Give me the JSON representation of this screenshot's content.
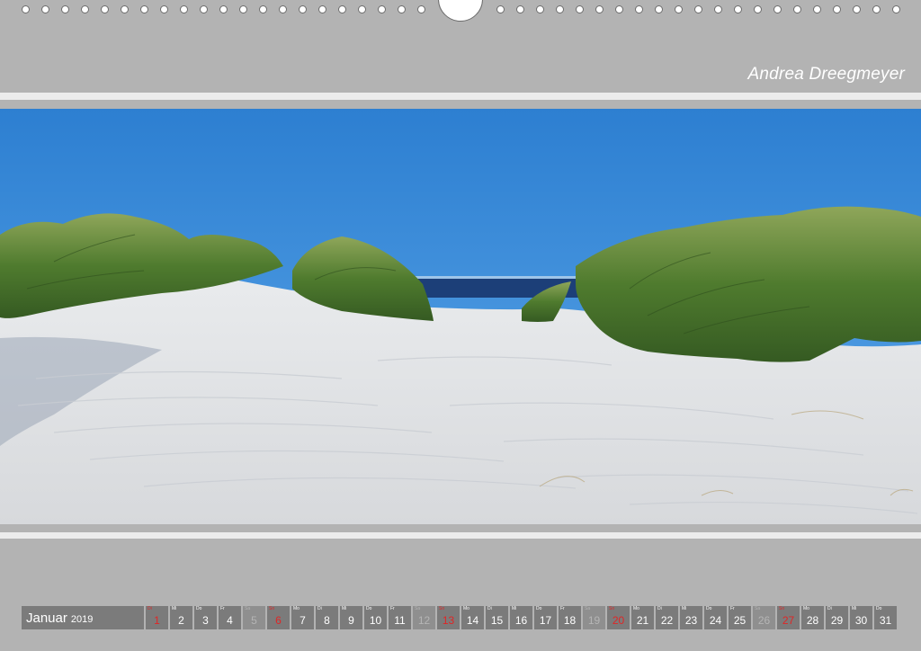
{
  "header": {
    "author": "Andrea Dreegmeyer"
  },
  "calendar": {
    "month": "Januar",
    "year": "2019",
    "days": [
      {
        "num": "1",
        "dn": "Di",
        "type": "sun"
      },
      {
        "num": "2",
        "dn": "Mi",
        "type": "weekday"
      },
      {
        "num": "3",
        "dn": "Do",
        "type": "weekday"
      },
      {
        "num": "4",
        "dn": "Fr",
        "type": "weekday"
      },
      {
        "num": "5",
        "dn": "Sa",
        "type": "sat"
      },
      {
        "num": "6",
        "dn": "So",
        "type": "sun"
      },
      {
        "num": "7",
        "dn": "Mo",
        "type": "weekday"
      },
      {
        "num": "8",
        "dn": "Di",
        "type": "weekday"
      },
      {
        "num": "9",
        "dn": "Mi",
        "type": "weekday"
      },
      {
        "num": "10",
        "dn": "Do",
        "type": "weekday"
      },
      {
        "num": "11",
        "dn": "Fr",
        "type": "weekday"
      },
      {
        "num": "12",
        "dn": "Sa",
        "type": "sat"
      },
      {
        "num": "13",
        "dn": "So",
        "type": "sun"
      },
      {
        "num": "14",
        "dn": "Mo",
        "type": "weekday"
      },
      {
        "num": "15",
        "dn": "Di",
        "type": "weekday"
      },
      {
        "num": "16",
        "dn": "Mi",
        "type": "weekday"
      },
      {
        "num": "17",
        "dn": "Do",
        "type": "weekday"
      },
      {
        "num": "18",
        "dn": "Fr",
        "type": "weekday"
      },
      {
        "num": "19",
        "dn": "Sa",
        "type": "sat"
      },
      {
        "num": "20",
        "dn": "So",
        "type": "sun"
      },
      {
        "num": "21",
        "dn": "Mo",
        "type": "weekday"
      },
      {
        "num": "22",
        "dn": "Di",
        "type": "weekday"
      },
      {
        "num": "23",
        "dn": "Mi",
        "type": "weekday"
      },
      {
        "num": "24",
        "dn": "Do",
        "type": "weekday"
      },
      {
        "num": "25",
        "dn": "Fr",
        "type": "weekday"
      },
      {
        "num": "26",
        "dn": "Sa",
        "type": "sat"
      },
      {
        "num": "27",
        "dn": "So",
        "type": "sun"
      },
      {
        "num": "28",
        "dn": "Mo",
        "type": "weekday"
      },
      {
        "num": "29",
        "dn": "Di",
        "type": "weekday"
      },
      {
        "num": "30",
        "dn": "Mi",
        "type": "weekday"
      },
      {
        "num": "31",
        "dn": "Do",
        "type": "weekday"
      }
    ]
  }
}
